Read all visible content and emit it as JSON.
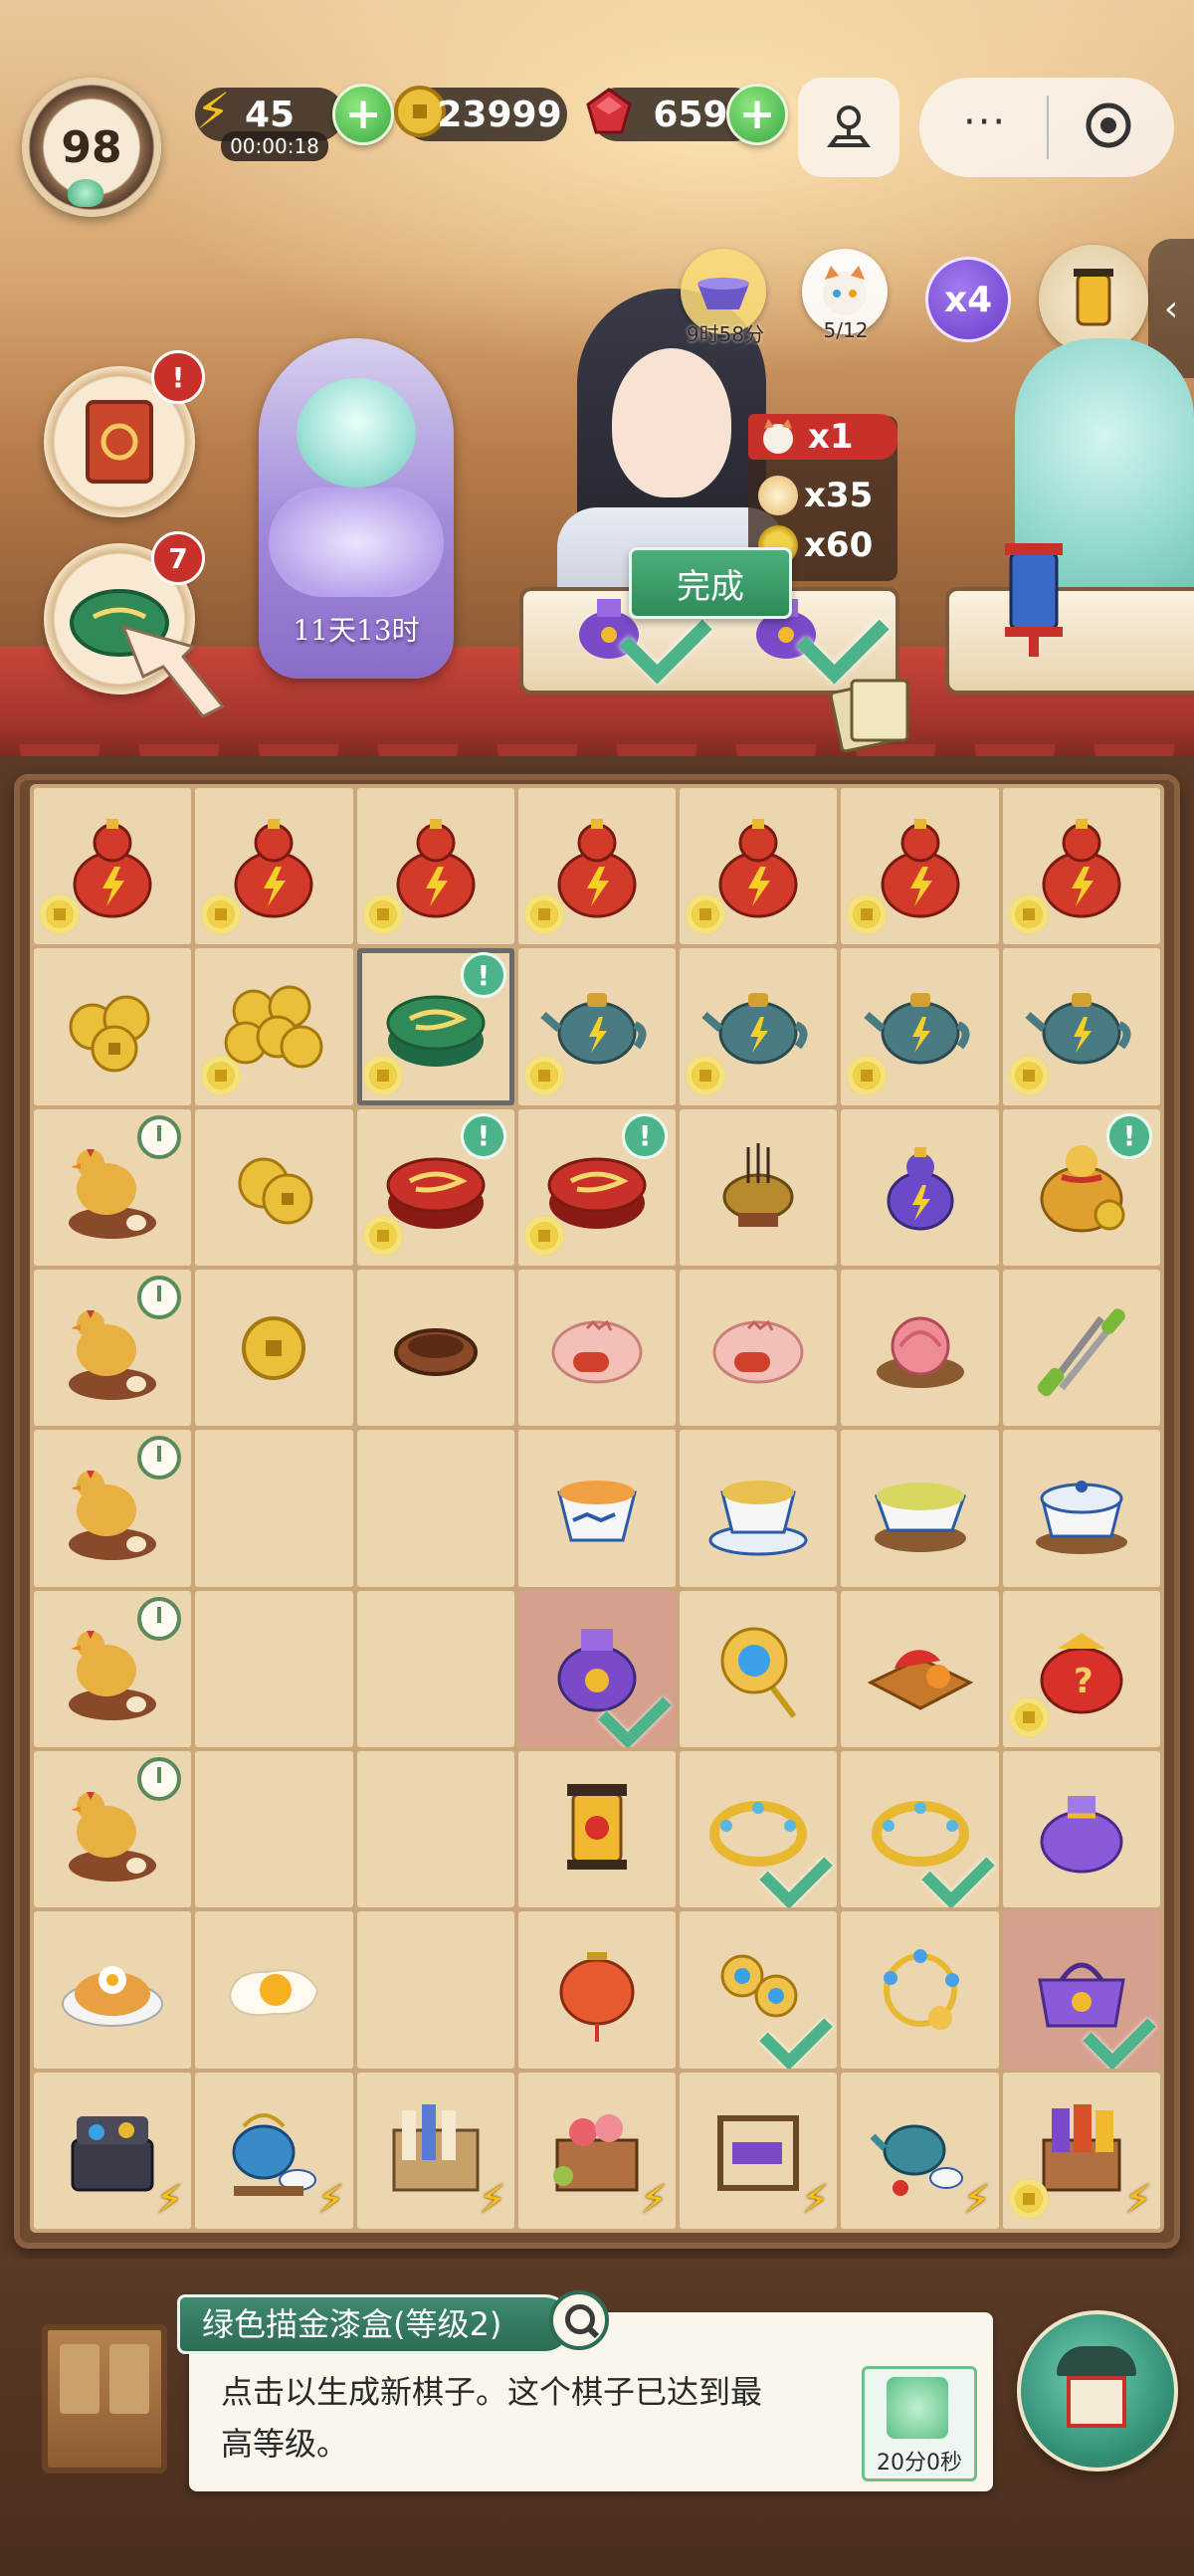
{
  "hud": {
    "level": "98",
    "energy": "45",
    "energy_timer": "00:00:18",
    "coins": "23999",
    "gems": "659",
    "menu_dots": "···"
  },
  "left_badges": {
    "book_notice": "!",
    "box_count": "7"
  },
  "event": {
    "countdown": "11天13时"
  },
  "order": {
    "timer": "9时58分",
    "cat_progress": "5/12",
    "multiplier": "x4",
    "reward_x1": "x1",
    "reward_cloud": "x35",
    "reward_coin": "x60",
    "done_label": "完成"
  },
  "board": {
    "columns": 7,
    "rows": 9,
    "cells": [
      [
        "red-gourd",
        "red-gourd",
        "red-gourd",
        "red-gourd",
        "red-gourd",
        "red-gourd",
        "red-gourd"
      ],
      [
        "coins-3",
        "coins-5",
        "green-box",
        "teapot",
        "teapot",
        "teapot",
        "teapot"
      ],
      [
        "hen-nest",
        "coins-2",
        "red-box",
        "red-box",
        "incense-burner",
        "purple-gourd",
        "coin-bag"
      ],
      [
        "hen-nest",
        "coin-1",
        "bird-nest",
        "pink-cake",
        "pink-cake",
        "peach-bun",
        "scissors"
      ],
      [
        "hen-nest",
        "",
        "",
        "tea-cup",
        "tea-cup-saucer",
        "tea-bowl",
        "covered-tea-bowl"
      ],
      [
        "hen-nest",
        "",
        "",
        "purple-pouch",
        "gem-hairpin",
        "watermelon-plate",
        "lucky-bag"
      ],
      [
        "hen-nest",
        "",
        "",
        "palace-lantern",
        "gold-bracelet",
        "gold-bracelet",
        "purple-bag"
      ],
      [
        "fried-rice",
        "fried-egg",
        "",
        "red-lantern",
        "flower-pin",
        "bead-bracelet",
        "purple-handbag"
      ],
      [
        "treasure-chest",
        "tea-set",
        "scroll-shelf",
        "flower-cart",
        "loom",
        "teapot-cups",
        "fabric-cart"
      ]
    ]
  },
  "detail": {
    "title": "绿色描金漆盒(等级2)",
    "description": "点击以生成新棋子。这个棋子已达到最高等级。",
    "timer": "20分0秒"
  },
  "colors": {
    "accent_green": "#2c6c54",
    "notif_red": "#c8302a",
    "board_tile": "#ecd6b0"
  }
}
